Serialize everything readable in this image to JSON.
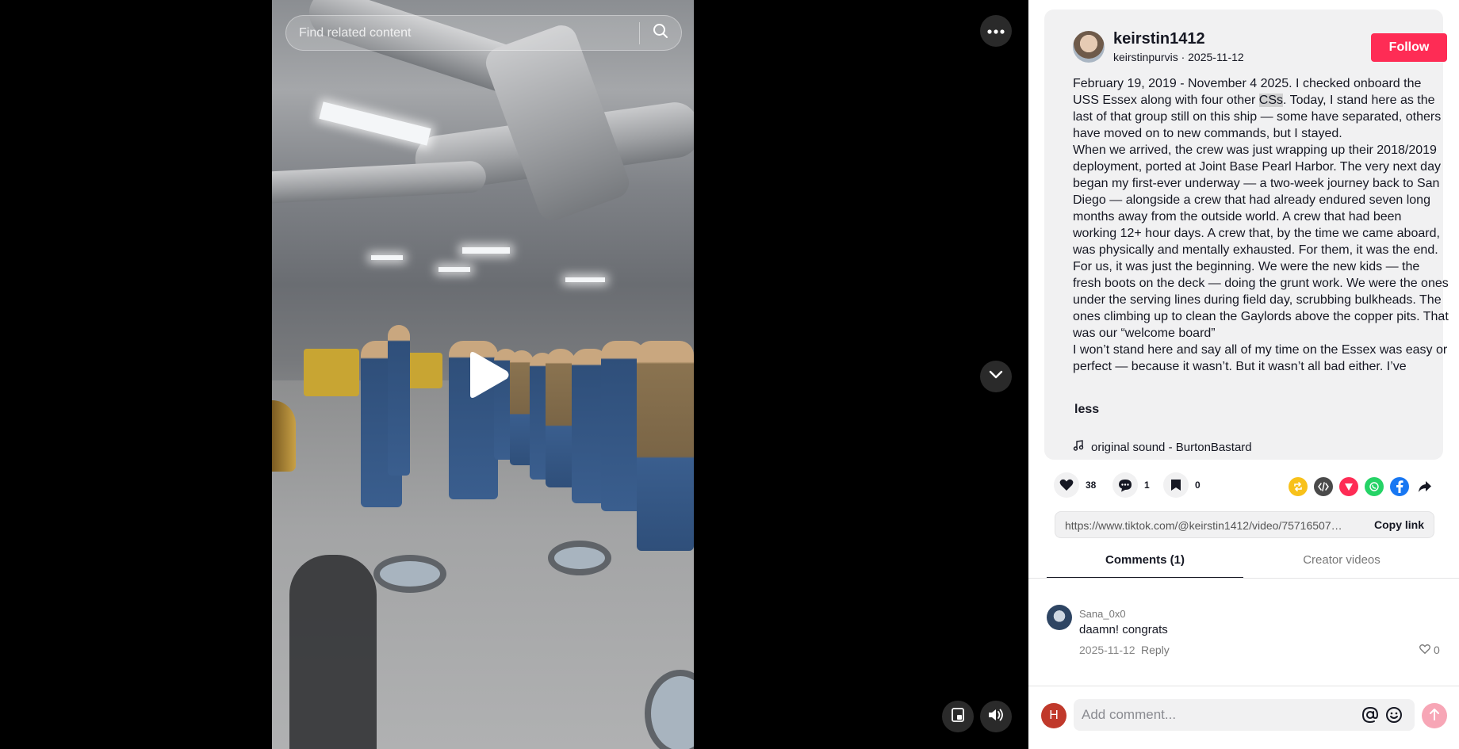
{
  "search": {
    "placeholder": "Find related content"
  },
  "author": {
    "username": "keirstin1412",
    "nickname": "keirstinpurvis",
    "date": "2025-11-12",
    "meta": "keirstinpurvis · 2025-11-12",
    "follow_label": "Follow"
  },
  "description": {
    "p1_before": "February 19, 2019 - November 4 2025. I checked onboard the USS Essex along with four other ",
    "p1_highlight": "CSs",
    "p1_after": ". Today, I stand here as the last of that group still on this ship — some have separated, others have moved on to new commands, but I stayed.",
    "p2": "When we arrived, the crew was just wrapping up their 2018/2019 deployment, ported at Joint Base Pearl Harbor. The very next day began my first-ever underway — a two-week journey back to San Diego — alongside a crew that had already endured seven long months away from the outside world. A crew that had been working 12+ hour days. A crew that, by the time we came aboard, was physically and mentally exhausted. For them, it was the end. For us, it was just the beginning. We were the new kids — the fresh boots on the deck — doing the grunt work. We were the ones under the serving lines during field day, scrubbing bulkheads. The ones climbing up to clean the Gaylords above the copper pits. That was our “welcome board”",
    "p3": "I won’t stand here and say all of my time on the Essex was easy or perfect — because it wasn’t. But it wasn’t all bad either. I’ve",
    "less_label": "less"
  },
  "music": {
    "label": "original sound - BurtonBastard"
  },
  "actions": {
    "likes": "38",
    "comments": "1",
    "saves": "0"
  },
  "share": {
    "icons": [
      "repost-icon",
      "embed-icon",
      "send-icon",
      "whatsapp-icon",
      "facebook-icon",
      "share-arrow-icon"
    ],
    "colors": {
      "repost": "#f8c11a",
      "embed": "#4a4a4a",
      "send": "#fe2c55",
      "whatsapp": "#25d366",
      "facebook": "#1877f2"
    }
  },
  "link": {
    "url": "https://www.tiktok.com/@keirstin1412/video/757165071...",
    "copy_label": "Copy link"
  },
  "tabs": {
    "comments": "Comments (1)",
    "creator": "Creator videos"
  },
  "comments": [
    {
      "user": "Sana_0x0",
      "text": "daamn! congrats",
      "date": "2025-11-12",
      "reply_label": "Reply",
      "likes": "0"
    }
  ],
  "composer": {
    "avatar_letter": "H",
    "placeholder": "Add comment..."
  },
  "colors": {
    "accent": "#fe2c55",
    "panel_bg": "#f1f1f2"
  }
}
